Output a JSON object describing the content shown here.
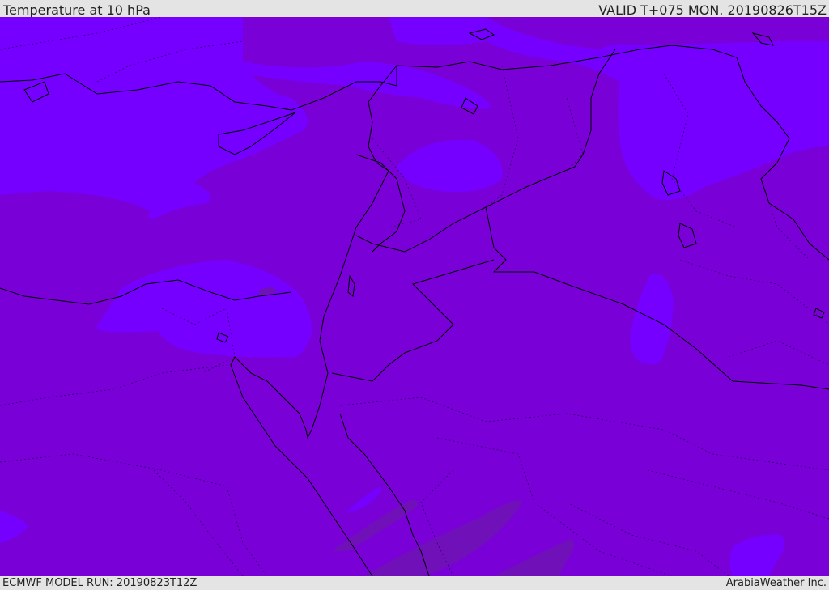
{
  "header": {
    "title": "Temperature at 10 hPa",
    "valid": "VALID T+075 MON. 20190826T15Z"
  },
  "footer": {
    "model_run": "ECMWF MODEL RUN: 20190823T12Z",
    "credit": "ArabiaWeather Inc."
  },
  "colors": {
    "base_field": "#7a00d8",
    "warm_field": "#7600ff",
    "cool_field": "#6f10b8",
    "coastline": "#000000"
  }
}
